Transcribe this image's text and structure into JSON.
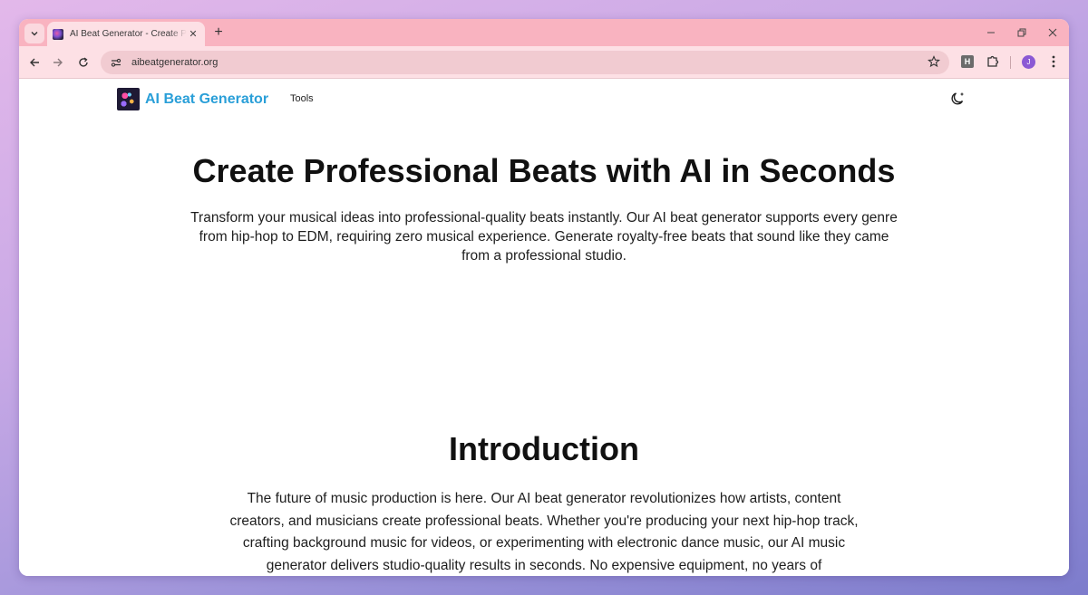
{
  "browser": {
    "tab": {
      "title": "AI Beat Generator - Create Professional Beats with AI in Seconds",
      "close_label": "✕"
    },
    "new_tab_label": "+",
    "url": "aibeatgenerator.org",
    "extension_label": "H",
    "profile_initial": "J"
  },
  "site": {
    "brand_name": "AI Beat Generator",
    "nav": {
      "tools_label": "Tools"
    }
  },
  "hero": {
    "title": "Create Professional Beats with AI in Seconds",
    "subtitle": "Transform your musical ideas into professional-quality beats instantly. Our AI beat generator supports every genre from hip-hop to EDM, requiring zero musical experience. Generate royalty-free beats that sound like they came from a professional studio."
  },
  "intro": {
    "title": "Introduction",
    "body": "The future of music production is here. Our AI beat generator revolutionizes how artists, content creators, and musicians create professional beats. Whether you're producing your next hip-hop track, crafting background music for videos, or experimenting with electronic dance music, our AI music generator delivers studio-quality results in seconds. No expensive equipment, no years of"
  },
  "colors": {
    "tabstrip": "#f9b3c0",
    "toolbar": "#fde0e5",
    "brand_accent": "#2a9fd8"
  },
  "icons": [
    "tab-search-icon",
    "close-icon",
    "plus-icon",
    "minimize-icon",
    "restore-icon",
    "back-arrow-icon",
    "forward-arrow-icon",
    "reload-icon",
    "site-info-icon",
    "star-icon",
    "puzzle-icon",
    "more-vertical-icon",
    "moon-icon"
  ]
}
